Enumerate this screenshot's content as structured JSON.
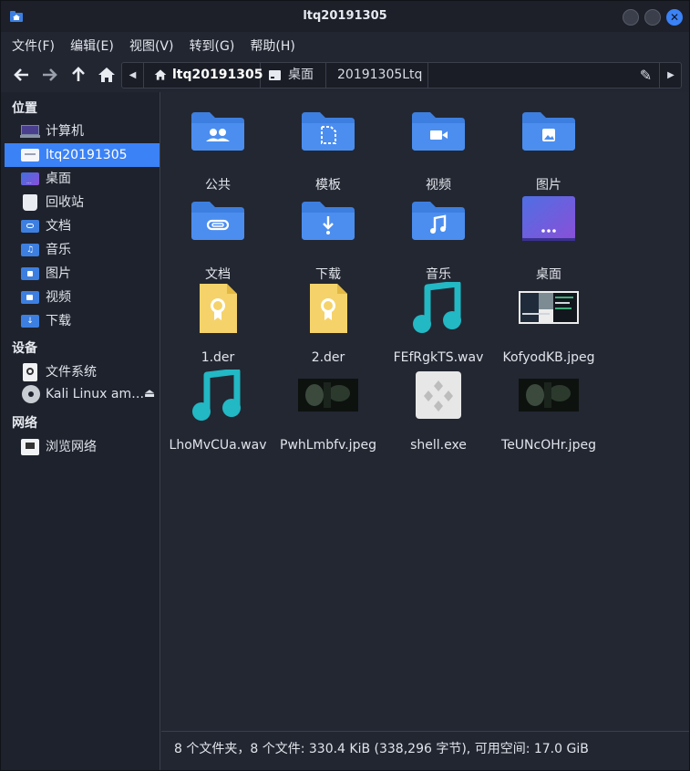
{
  "window": {
    "title": "ltq20191305",
    "close_glyph": "✕"
  },
  "menu": [
    {
      "label": "文件(F)"
    },
    {
      "label": "编辑(E)"
    },
    {
      "label": "视图(V)"
    },
    {
      "label": "转到(G)"
    },
    {
      "label": "帮助(H)"
    }
  ],
  "nav": {
    "back": "🡐",
    "forward": "🡒",
    "up": "🡑",
    "home": "⌂"
  },
  "pathbar": {
    "left_arrow": "◀",
    "right_arrow": "▶",
    "edit_glyph": "✎",
    "segments": [
      {
        "label": "ltq20191305",
        "active": true,
        "icon": "home-icon"
      },
      {
        "label": "桌面",
        "active": false,
        "icon": "desktop-icon"
      },
      {
        "label": "20191305Ltq",
        "active": false
      }
    ]
  },
  "sidebar": {
    "sections": [
      {
        "title": "位置"
      },
      {
        "title": "设备"
      },
      {
        "title": "网络"
      }
    ],
    "places": [
      {
        "label": "计算机",
        "icon": "computer-icon"
      },
      {
        "label": "ltq20191305",
        "icon": "home-folder-icon",
        "selected": true
      },
      {
        "label": "桌面",
        "icon": "desktop-icon"
      },
      {
        "label": "回收站",
        "icon": "trash-icon"
      },
      {
        "label": "文档",
        "icon": "documents-icon"
      },
      {
        "label": "音乐",
        "icon": "music-icon"
      },
      {
        "label": "图片",
        "icon": "pictures-icon"
      },
      {
        "label": "视频",
        "icon": "videos-icon"
      },
      {
        "label": "下载",
        "icon": "downloads-icon"
      }
    ],
    "devices": [
      {
        "label": "文件系统",
        "icon": "drive-icon"
      },
      {
        "label": "Kali Linux am…",
        "icon": "disc-icon",
        "eject": "⏏"
      }
    ],
    "network": [
      {
        "label": "浏览网络",
        "icon": "network-icon"
      }
    ]
  },
  "files": [
    {
      "name": "公共",
      "kind": "folder",
      "glyph": "people"
    },
    {
      "name": "模板",
      "kind": "folder",
      "glyph": "template"
    },
    {
      "name": "视频",
      "kind": "folder",
      "glyph": "video"
    },
    {
      "name": "图片",
      "kind": "folder",
      "glyph": "picture"
    },
    {
      "name": "文档",
      "kind": "folder",
      "glyph": "clip"
    },
    {
      "name": "下载",
      "kind": "folder",
      "glyph": "download"
    },
    {
      "name": "音乐",
      "kind": "folder",
      "glyph": "music"
    },
    {
      "name": "桌面",
      "kind": "desktop"
    },
    {
      "name": "1.der",
      "kind": "cert"
    },
    {
      "name": "2.der",
      "kind": "cert"
    },
    {
      "name": "FEfRgkTS.wav",
      "kind": "audio"
    },
    {
      "name": "KofyodKB.jpeg",
      "kind": "image-screen"
    },
    {
      "name": "LhoMvCUa.wav",
      "kind": "audio"
    },
    {
      "name": "PwhLmbfv.jpeg",
      "kind": "image-dark"
    },
    {
      "name": "shell.exe",
      "kind": "exe"
    },
    {
      "name": "TeUNcOHr.jpeg",
      "kind": "image-dark"
    }
  ],
  "status": {
    "text": "8 个文件夹，8 个文件: 330.4 KiB (338,296 字节), 可用空间: 17.0 GiB"
  },
  "colors": {
    "accent": "#3b82f6",
    "folder": "#3d7fe0",
    "audio": "#22b8c4",
    "cert": "#f5d36a"
  }
}
